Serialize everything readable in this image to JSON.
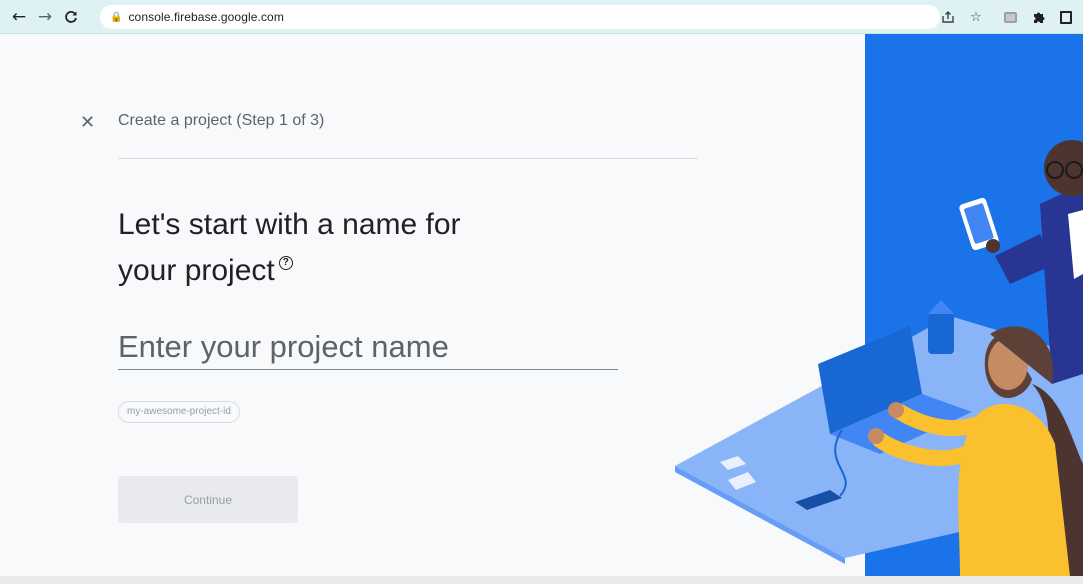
{
  "browser": {
    "back_icon": "arrow-left-icon",
    "forward_icon": "arrow-right-icon",
    "reload_icon": "reload-icon",
    "lock_icon": "lock-icon",
    "url": "console.firebase.google.com",
    "share_icon": "share-icon",
    "bookmark_icon": "star-icon",
    "extension_icon": "extension-icon",
    "puzzle_icon": "puzzle-icon",
    "sidepanel_icon": "side-panel-icon"
  },
  "wizard": {
    "close_icon": "close-icon",
    "step_title": "Create a project (Step 1 of 3)",
    "headline_line1": "Let's start with a name for",
    "headline_line2": "your project",
    "help_icon": "help-icon",
    "name_placeholder": "Enter your project name",
    "name_value": "",
    "project_id": "my-awesome-project-id",
    "continue_label": "Continue"
  },
  "colors": {
    "illustration_blue": "#1a73e8",
    "table_blue": "#8ab4f8",
    "sweater_yellow": "#fbc02d"
  }
}
